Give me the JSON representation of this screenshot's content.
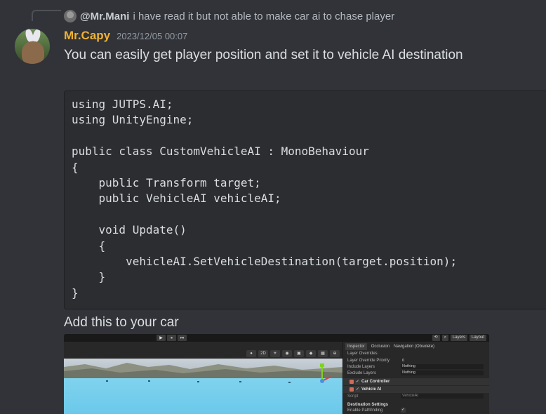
{
  "reply": {
    "author": "@Mr.Mani",
    "text": "i have read it but not able to make car ai to chase player"
  },
  "message": {
    "author": "Mr.Capy",
    "timestamp": "2023/12/05 00:07",
    "text": "You can easily get player position and set it to vehicle AI destination",
    "code": "using JUTPS.AI;\nusing UnityEngine;\n\npublic class CustomVehicleAI : MonoBehaviour\n{\n    public Transform target;\n    public VehicleAI vehicleAI;\n\n    void Update()\n    {\n        vehicleAI.SetVehicleDestination(target.position);\n    }\n}",
    "caption": "Add this to your car"
  },
  "screenshot": {
    "top_right": [
      "Layers",
      "Layout"
    ],
    "play_controls": [
      "▶",
      "⏸",
      "⏭"
    ],
    "scene_tools": [
      "●",
      "2D",
      "☀",
      "◉",
      "▣",
      "◆",
      "▦",
      "⊕"
    ],
    "inspector": {
      "tabs": [
        "Inspector",
        "Occlusion",
        "Navigation (Obsolete)"
      ],
      "rows": [
        {
          "label": "Layer Overrides",
          "value": ""
        },
        {
          "label": "Layer Override Priority",
          "value": "0"
        },
        {
          "label": "Include Layers",
          "value": "Nothing"
        },
        {
          "label": "Exclude Layers",
          "value": "Nothing"
        }
      ],
      "components": [
        "Car Controller",
        "Vehicle AI"
      ],
      "script_label": "Script",
      "script_value": "VehicleAI",
      "section": "Destination Settings",
      "field": "Enable Pathfinding"
    }
  },
  "colors": {
    "author": "#f0b232",
    "background": "#313338",
    "code_bg": "#2b2d31"
  }
}
